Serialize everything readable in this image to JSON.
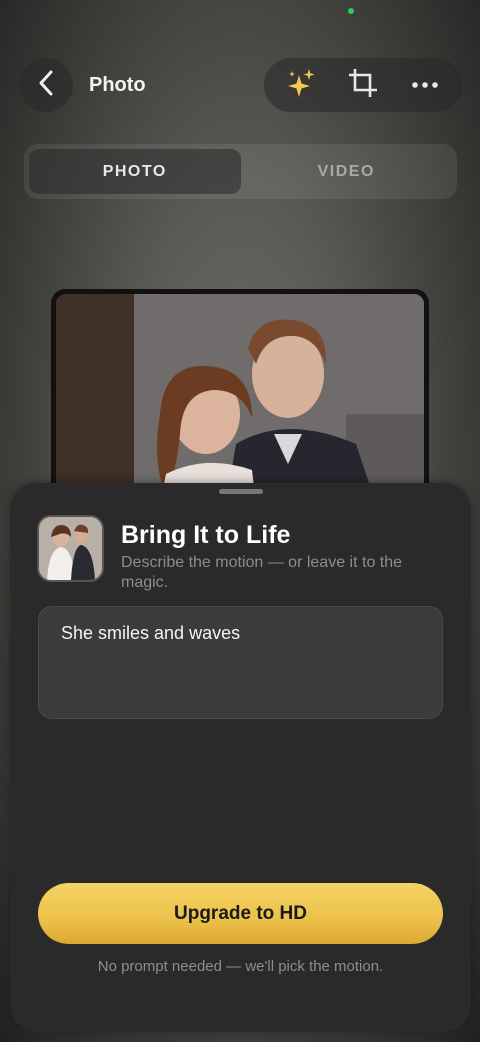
{
  "header": {
    "title": "Photo",
    "back_icon": "chevron-left-icon",
    "tools": [
      {
        "name": "sparkles-icon",
        "color": "#f2c94c"
      },
      {
        "name": "crop-icon",
        "color": "#e8e8e8"
      },
      {
        "name": "more-icon",
        "color": "#e8e8e8"
      }
    ]
  },
  "segments": {
    "photo": "PHOTO",
    "video": "VIDEO",
    "active": "PHOTO"
  },
  "sheet": {
    "title": "Bring It to Life",
    "subtitle": "Describe the motion — or leave it to the magic.",
    "prompt_value": "She smiles and waves",
    "cta_label": "Upgrade to HD",
    "footnote": "No prompt needed — we'll pick the motion."
  },
  "colors": {
    "accent": "#f2c94c",
    "sheet_bg": "#2a2a2a",
    "status_dot": "#34c759"
  }
}
